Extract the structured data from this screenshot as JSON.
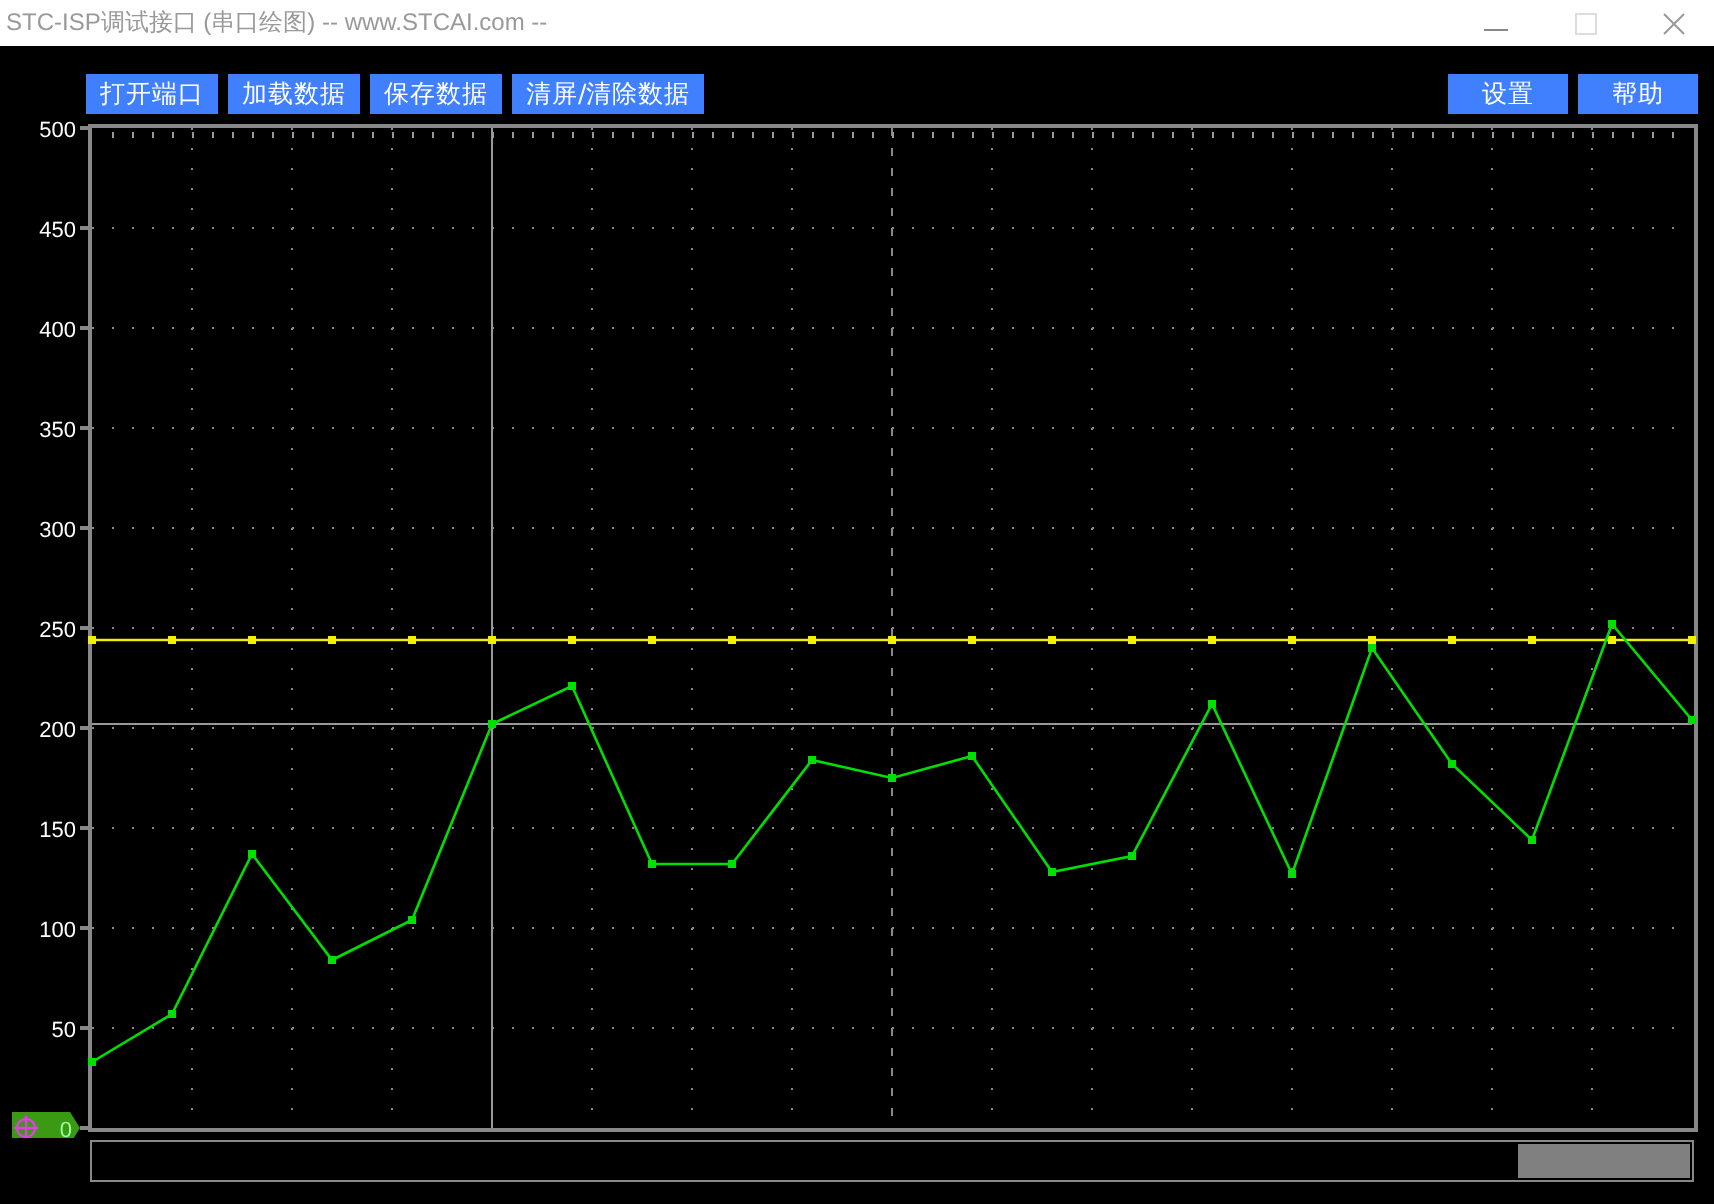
{
  "window": {
    "title": "STC-ISP调试接口 (串口绘图) -- www.STCAI.com --"
  },
  "toolbar": {
    "left_buttons": [
      "打开端口",
      "加载数据",
      "保存数据",
      "清屏/清除数据"
    ],
    "right_buttons": [
      "设置",
      "帮助"
    ]
  },
  "plot": {
    "chart_data": {
      "type": "line",
      "grid": true,
      "ylim": [
        0,
        500
      ],
      "yticks": [
        0,
        50,
        100,
        150,
        200,
        250,
        300,
        350,
        400,
        450,
        500
      ],
      "series": [
        {
          "color": "#00e000",
          "marker": "square",
          "values": [
            33,
            57,
            137,
            84,
            104,
            202,
            221,
            132,
            132,
            184,
            175,
            186,
            128,
            136,
            212,
            127,
            240,
            182,
            144,
            252,
            204
          ]
        },
        {
          "color": "#f0f000",
          "marker": "square",
          "values": [
            244,
            244,
            244,
            244,
            244,
            244,
            244,
            244,
            244,
            244,
            244,
            244,
            244,
            244,
            244,
            244,
            244,
            244,
            244,
            244,
            244
          ]
        }
      ]
    }
  }
}
